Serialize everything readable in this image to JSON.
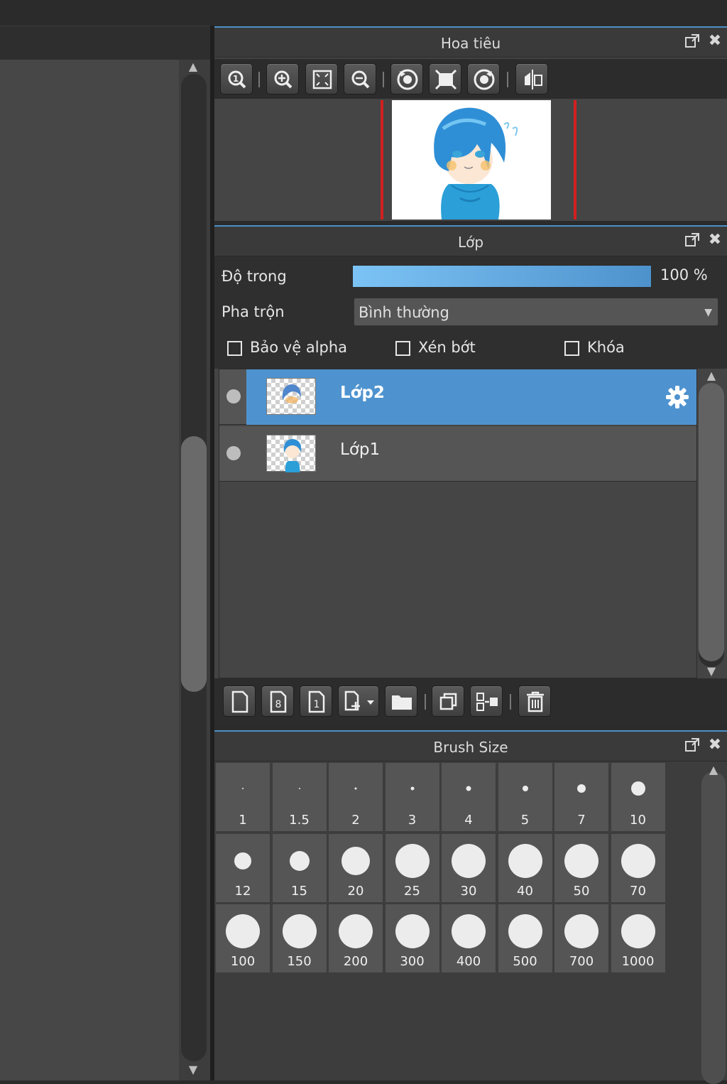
{
  "navigator": {
    "title": "Hoa tiêu",
    "tools": [
      "zoom-actual-icon",
      "zoom-in-icon",
      "fit-screen-icon",
      "zoom-out-icon",
      "rotate-left-icon",
      "fit-width-icon",
      "rotate-right-icon",
      "flip-horizontal-icon"
    ]
  },
  "layers": {
    "title": "Lớp",
    "opacity_label": "Độ trong",
    "opacity_value": "100 %",
    "opacity_fraction": 1.0,
    "blend_label": "Pha trộn",
    "blend_value": "Bình thường",
    "protect_alpha_label": "Bảo vệ alpha",
    "clipping_label": "Xén bớt",
    "lock_label": "Khóa",
    "items": [
      {
        "name": "Lớp2",
        "selected": true
      },
      {
        "name": "Lớp1",
        "selected": false
      }
    ],
    "tools": [
      "new-layer-icon",
      "new-8bit-layer-icon",
      "new-1bit-layer-icon",
      "add-layer-menu-icon",
      "folder-icon",
      "duplicate-layer-icon",
      "merge-layer-icon",
      "delete-layer-icon"
    ]
  },
  "brush_size": {
    "title": "Brush Size",
    "sizes": [
      "1",
      "1.5",
      "2",
      "3",
      "4",
      "5",
      "7",
      "10",
      "12",
      "15",
      "20",
      "25",
      "30",
      "40",
      "50",
      "70",
      "100",
      "150",
      "200",
      "300",
      "400",
      "500",
      "700",
      "1000"
    ]
  },
  "colors": {
    "accent": "#4a90c8",
    "selected_row": "#4e93cf",
    "panel_bg": "#444444"
  }
}
